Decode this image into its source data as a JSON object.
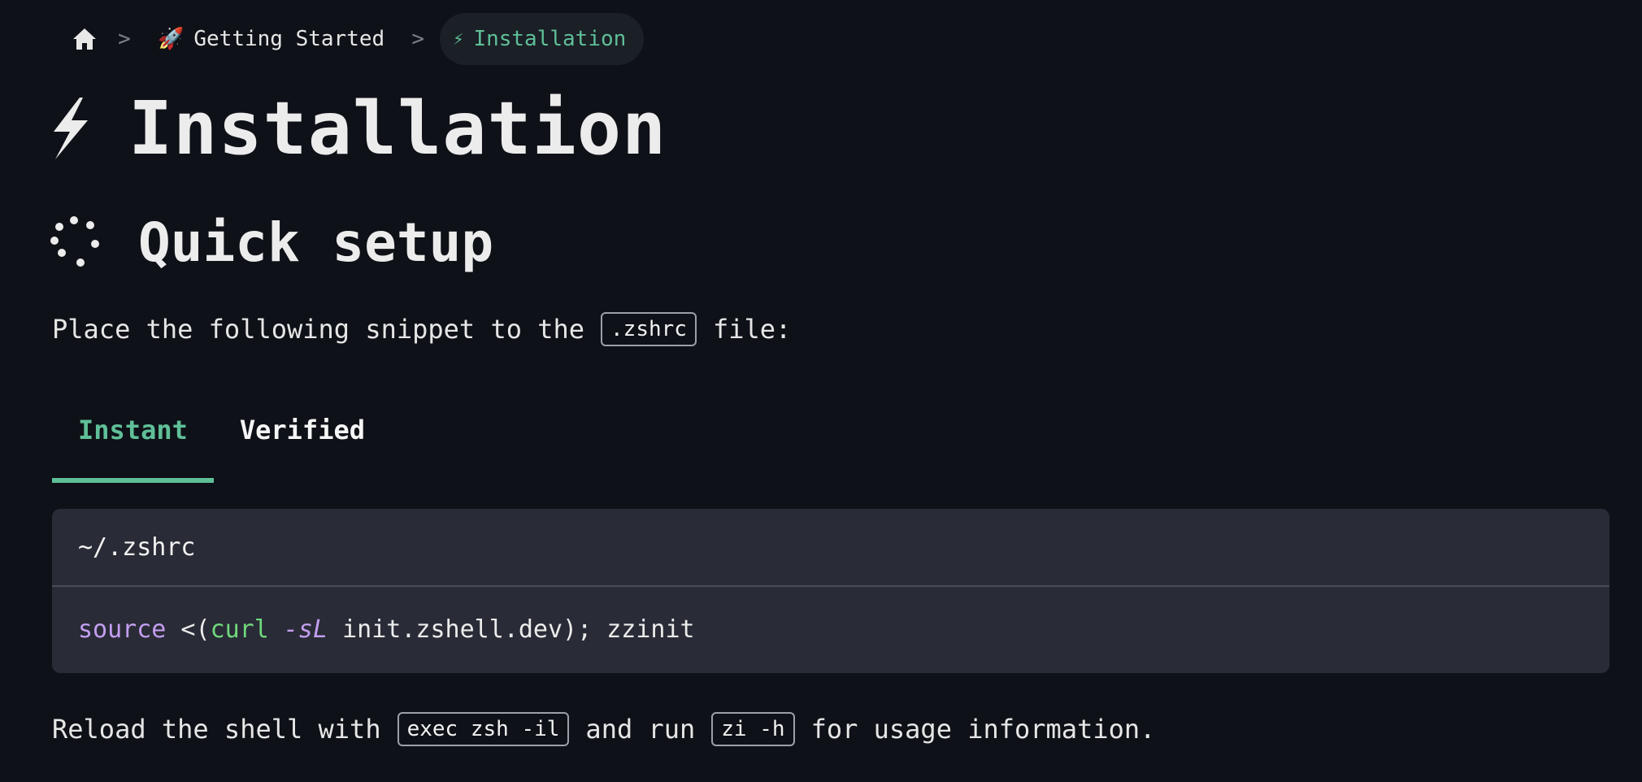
{
  "breadcrumb": {
    "home_icon": "home-icon",
    "items": [
      {
        "emoji": "🚀",
        "label": "Getting Started"
      },
      {
        "emoji": "⚡",
        "label": "Installation"
      }
    ],
    "separator": ">"
  },
  "page": {
    "title": "Installation",
    "title_icon": "lightning-icon",
    "section_title": "Quick setup",
    "section_icon": "spinner-dots-icon"
  },
  "intro": {
    "before": "Place the following snippet to the",
    "code": ".zshrc",
    "after": "file:"
  },
  "tabs": [
    {
      "label": "Instant",
      "active": true
    },
    {
      "label": "Verified",
      "active": false
    }
  ],
  "code_block": {
    "filename": "~/.zshrc",
    "line": {
      "kw": "source",
      "t1": " <(",
      "cmd": "curl",
      "sp": " ",
      "flag": "-sL",
      "rest": " init.zshell.dev); zzinit"
    }
  },
  "outro": {
    "part1": "Reload the shell with",
    "code1": "exec zsh -il",
    "part2": "and run",
    "code2": "zi -h",
    "part3": "for usage information."
  },
  "colors": {
    "background": "#0e1117",
    "accent": "#5fbf98",
    "code_bg": "#292b36",
    "keyword": "#c49ef0",
    "command": "#6fd97b"
  }
}
